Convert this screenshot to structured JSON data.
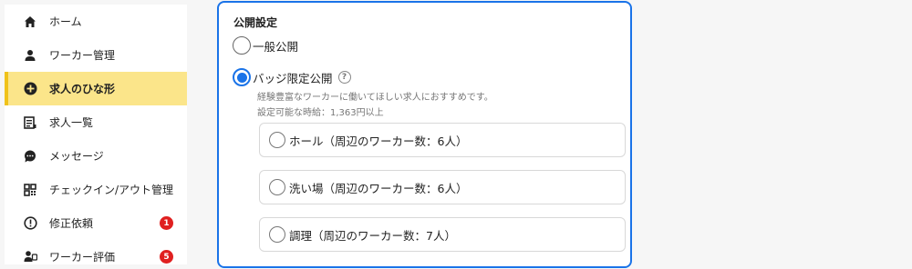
{
  "sidebar": {
    "items": [
      {
        "label": "ホーム",
        "icon": "home-icon",
        "active": false
      },
      {
        "label": "ワーカー管理",
        "icon": "person-icon",
        "active": false
      },
      {
        "label": "求人のひな形",
        "icon": "plus-circle-icon",
        "active": true
      },
      {
        "label": "求人一覧",
        "icon": "list-icon",
        "active": false
      },
      {
        "label": "メッセージ",
        "icon": "chat-bubble-icon",
        "active": false
      },
      {
        "label": "チェックイン/アウト管理",
        "icon": "qr-code-icon",
        "active": false
      },
      {
        "label": "修正依頼",
        "icon": "alert-circle-icon",
        "active": false,
        "badge": "1"
      },
      {
        "label": "ワーカー評価",
        "icon": "person-rating-icon",
        "active": false,
        "badge": "5"
      }
    ],
    "collapse_glyph": "«"
  },
  "panel": {
    "section_title": "公開設定",
    "options": {
      "public": {
        "label": "一般公開",
        "checked": false
      },
      "badge_limited": {
        "label": "バッジ限定公開",
        "checked": true,
        "help_glyph": "?",
        "description": "経験豊富なワーカーに働いてほしい求人におすすめです。",
        "wage_note": "設定可能な時給：1,363円以上"
      }
    },
    "badges": [
      {
        "label": "ホール（周辺のワーカー数：6人）",
        "checked": false
      },
      {
        "label": "洗い場（周辺のワーカー数：6人）",
        "checked": false
      },
      {
        "label": "調理（周辺のワーカー数：7人）",
        "checked": false
      }
    ]
  },
  "colors": {
    "accent": "#1a73e8",
    "active_nav": "#fbe58a",
    "badge": "#e02020"
  }
}
